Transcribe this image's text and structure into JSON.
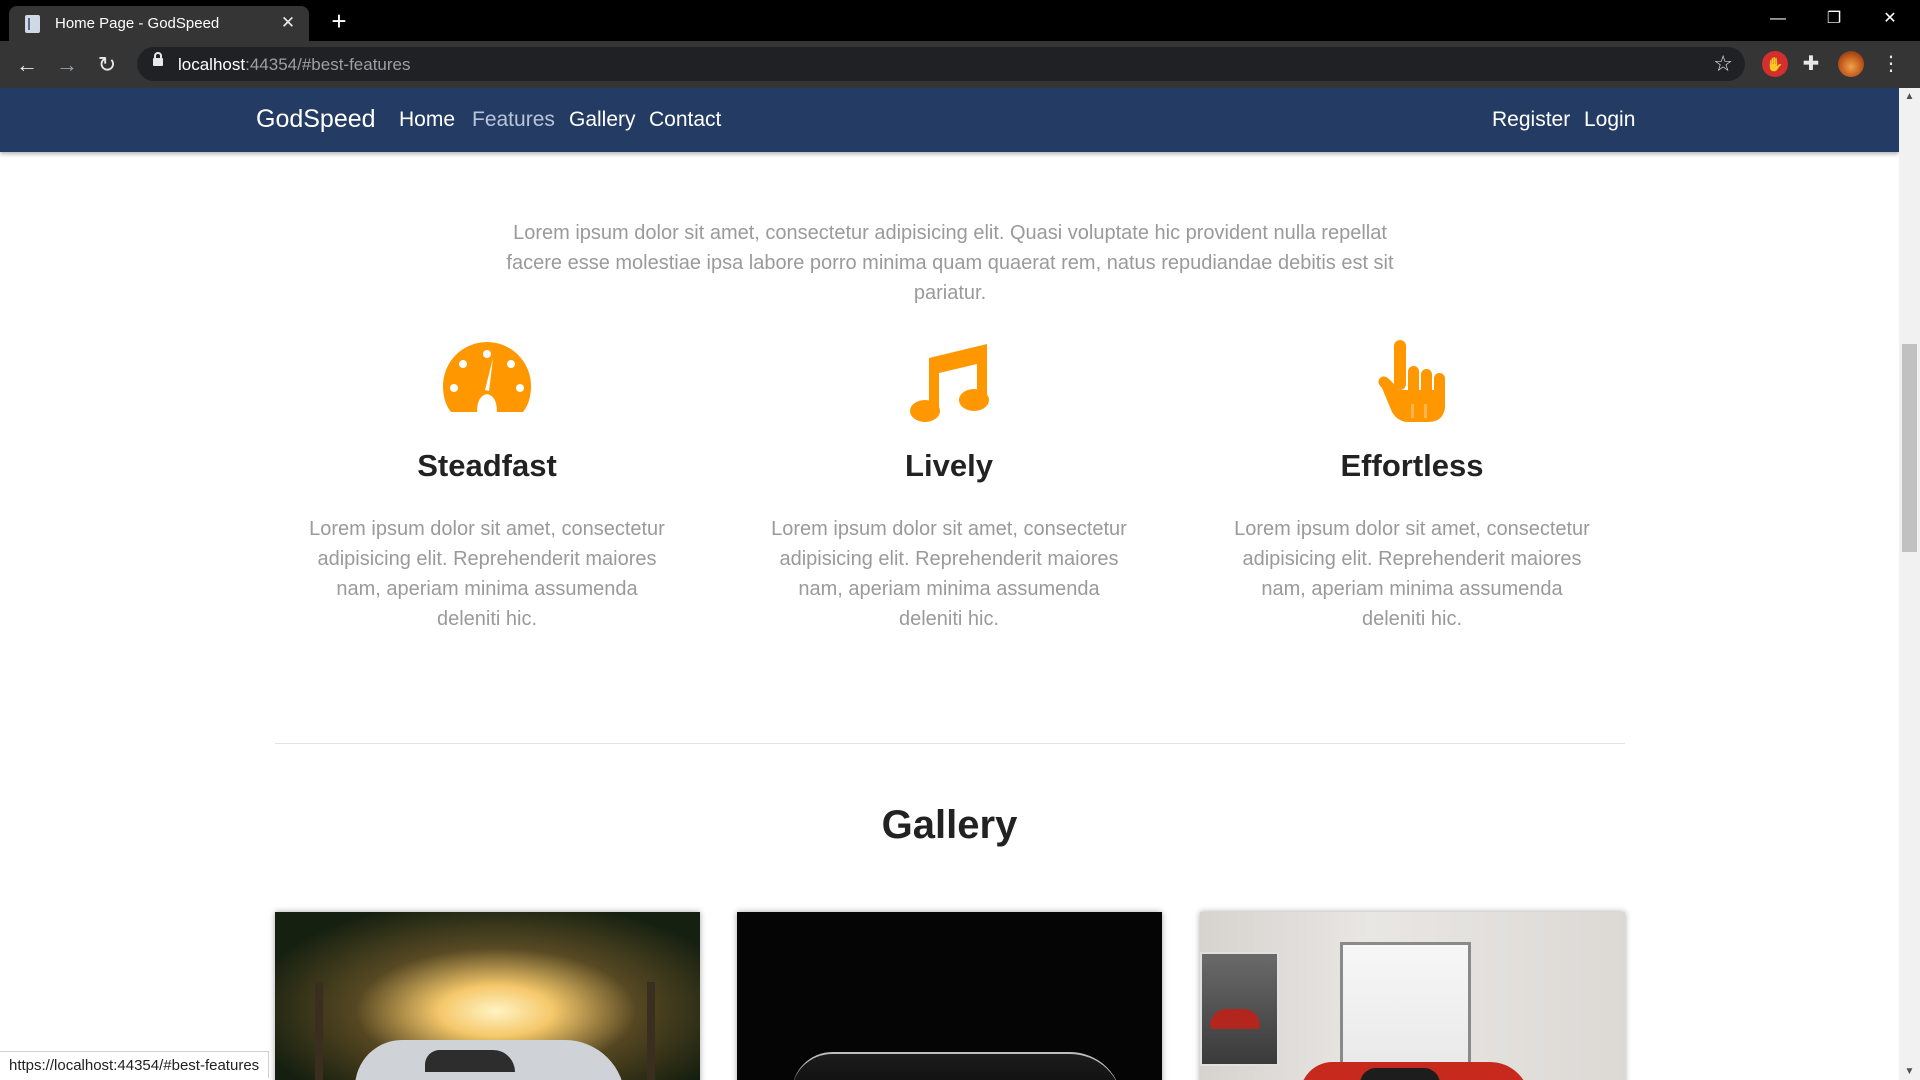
{
  "browser": {
    "tab_title": "Home Page - GodSpeed",
    "tab_close": "✕",
    "new_tab": "+",
    "url_host": "localhost",
    "url_rest": ":44354/#best-features",
    "status_link": "https://localhost:44354/#best-features",
    "icons": [
      "back-icon",
      "forward-icon",
      "reload-icon",
      "lock-icon",
      "star-icon",
      "extension-icon",
      "puzzle-icon",
      "profile-avatar",
      "menu-icon"
    ]
  },
  "site": {
    "brand": "GodSpeed",
    "nav_left": [
      "Home",
      "Features",
      "Gallery",
      "Contact"
    ],
    "nav_active": "Features",
    "nav_right": [
      "Register",
      "Login"
    ]
  },
  "intro_text": "Lorem ipsum dolor sit amet, consectetur adipisicing elit. Quasi voluptate hic provident nulla repellat facere esse molestiae ipsa labore porro minima quam quaerat rem, natus repudiandae debitis est sit pariatur.",
  "features": [
    {
      "icon": "speedometer-icon",
      "title": "Steadfast",
      "text": "Lorem ipsum dolor sit amet, consectetur adipisicing elit. Reprehenderit maiores nam, aperiam minima assumenda deleniti hic."
    },
    {
      "icon": "music-note-icon",
      "title": "Lively",
      "text": "Lorem ipsum dolor sit amet, consectetur adipisicing elit. Reprehenderit maiores nam, aperiam minima assumenda deleniti hic."
    },
    {
      "icon": "pointing-hand-icon",
      "title": "Effortless",
      "text": "Lorem ipsum dolor sit amet, consectetur adipisicing elit. Reprehenderit maiores nam, aperiam minima assumenda deleniti hic."
    }
  ],
  "gallery_title": "Gallery",
  "colors": {
    "navbar": "#243b63",
    "accent_orange": "#ff9800",
    "heading": "#222222",
    "muted_text": "#9a9a9a"
  }
}
